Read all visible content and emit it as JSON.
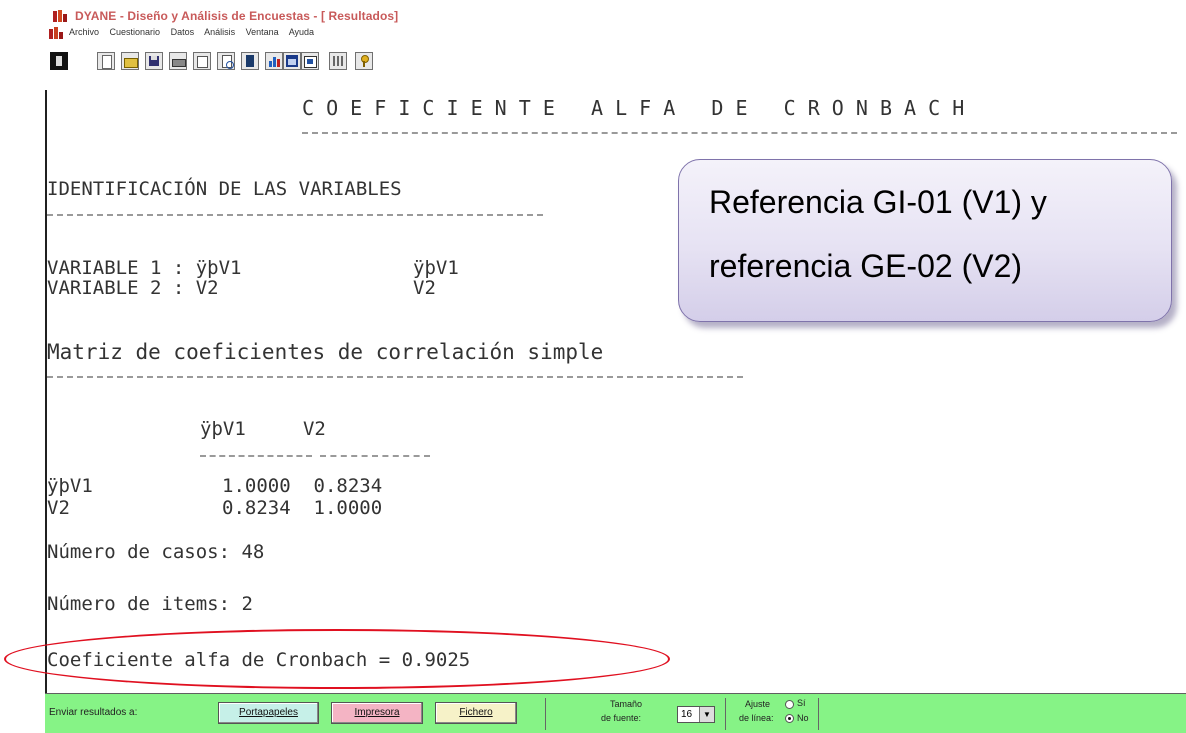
{
  "window": {
    "title": "DYANE - Diseño y Análisis de Encuestas - [ Resultados]"
  },
  "menu": {
    "items": [
      "Archivo",
      "Cuestionario",
      "Datos",
      "Análisis",
      "Ventana",
      "Ayuda"
    ]
  },
  "toolbar": {
    "buttons": [
      "exit-icon",
      "new-icon",
      "open-icon",
      "save-icon",
      "print-icon",
      "copy-icon",
      "preview-icon",
      "book-icon",
      "chart-icon",
      "table-icon",
      "window-icon",
      "columns-icon",
      "help-icon"
    ]
  },
  "report": {
    "heading": "C O E F I C I E N T E   A L F A   D E   C R O N B A C H",
    "section_variables": "IDENTIFICACIÓN DE LAS VARIABLES",
    "var1_line": "VARIABLE 1 : ÿþV1",
    "var1_name": "ÿþV1",
    "var2_line": "VARIABLE 2 : V2",
    "var2_name": "V2",
    "section_matrix": "Matriz de coeficientes de correlación simple",
    "matrix_header": "ÿþV1     V2",
    "matrix_dashes": "-------- --------",
    "matrix_rows": [
      {
        "label": "ÿþV1",
        "values": "1.0000  0.8234"
      },
      {
        "label": "V2",
        "values": "0.8234  1.0000"
      }
    ],
    "cases": "Número de casos: 48",
    "items": "Número de items: 2",
    "alpha": "Coeficiente alfa de Cronbach = 0.9025"
  },
  "callout": {
    "line1": "Referencia GI-01 (V1) y",
    "line2": "referencia GE-02 (V2)"
  },
  "statusbar": {
    "send_label": "Enviar resultados a:",
    "clipboard_button": "Portapapeles",
    "printer_button": "Impresora",
    "file_button": "Fichero",
    "font_size_label_1": "Tamaño",
    "font_size_label_2": "de fuente:",
    "font_size_value": "16",
    "wrap_label_1": "Ajuste",
    "wrap_label_2": "de línea:",
    "wrap_yes": "Sí",
    "wrap_no": "No",
    "wrap_selected": "No"
  },
  "colors": {
    "statusbar_bg": "#86f386",
    "clipboard_bg": "#c6f0e8",
    "printer_bg": "#f4b4c4",
    "file_bg": "#f6f2c8",
    "ellipse": "#e01020",
    "callout_border": "#7f73ab"
  }
}
